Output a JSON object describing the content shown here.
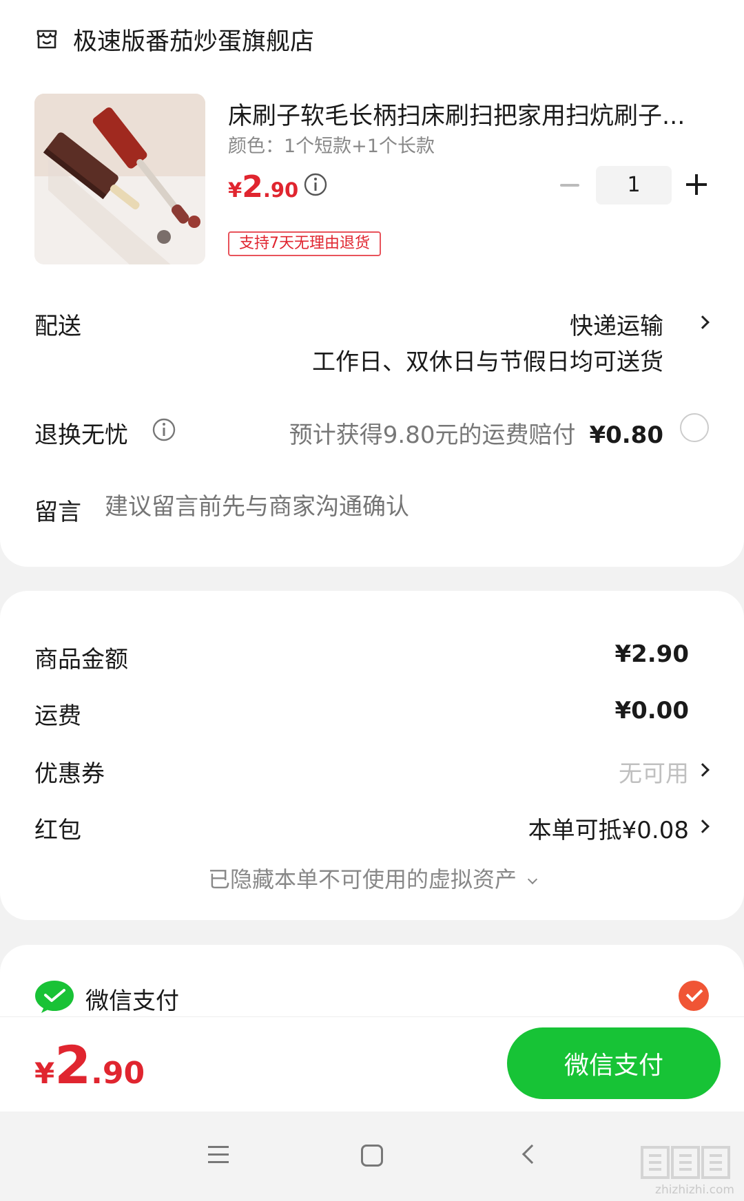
{
  "shop": {
    "name": "极速版番茄炒蛋旗舰店",
    "icon": "shop-icon"
  },
  "product": {
    "title": "床刷子软毛长柄扫床刷扫把家用扫炕刷子...",
    "spec": "颜色：1个短款+1个长款",
    "price_symbol": "¥",
    "price_int": "2",
    "price_dec": ".90",
    "quantity": "1",
    "badge": "支持7天无理由退货"
  },
  "delivery": {
    "label": "配送",
    "method": "快递运输",
    "note": "工作日、双休日与节假日均可送货"
  },
  "return_worry": {
    "label": "退换无忧",
    "text": "预计获得9.80元的运费赔付",
    "price": "¥0.80"
  },
  "message": {
    "label": "留言",
    "placeholder": "建议留言前先与商家沟通确认"
  },
  "summary": {
    "goods_label": "商品金额",
    "goods_value": "¥2.90",
    "shipping_label": "运费",
    "shipping_value": "¥0.00",
    "coupon_label": "优惠券",
    "coupon_value": "无可用",
    "redpacket_label": "红包",
    "redpacket_value": "本单可抵¥0.08",
    "hidden_assets": "已隐藏本单不可使用的虚拟资产"
  },
  "payment": {
    "method_label": "微信支付",
    "total_symbol": "¥",
    "total_int": "2",
    "total_dec": ".90",
    "button_label": "微信支付"
  },
  "colors": {
    "price_red": "#e0252f",
    "wechat_green": "#17c336",
    "check_orange": "#f05535"
  },
  "watermark": {
    "logo_text": "值值值",
    "sub": "zhizhizhi.com"
  }
}
